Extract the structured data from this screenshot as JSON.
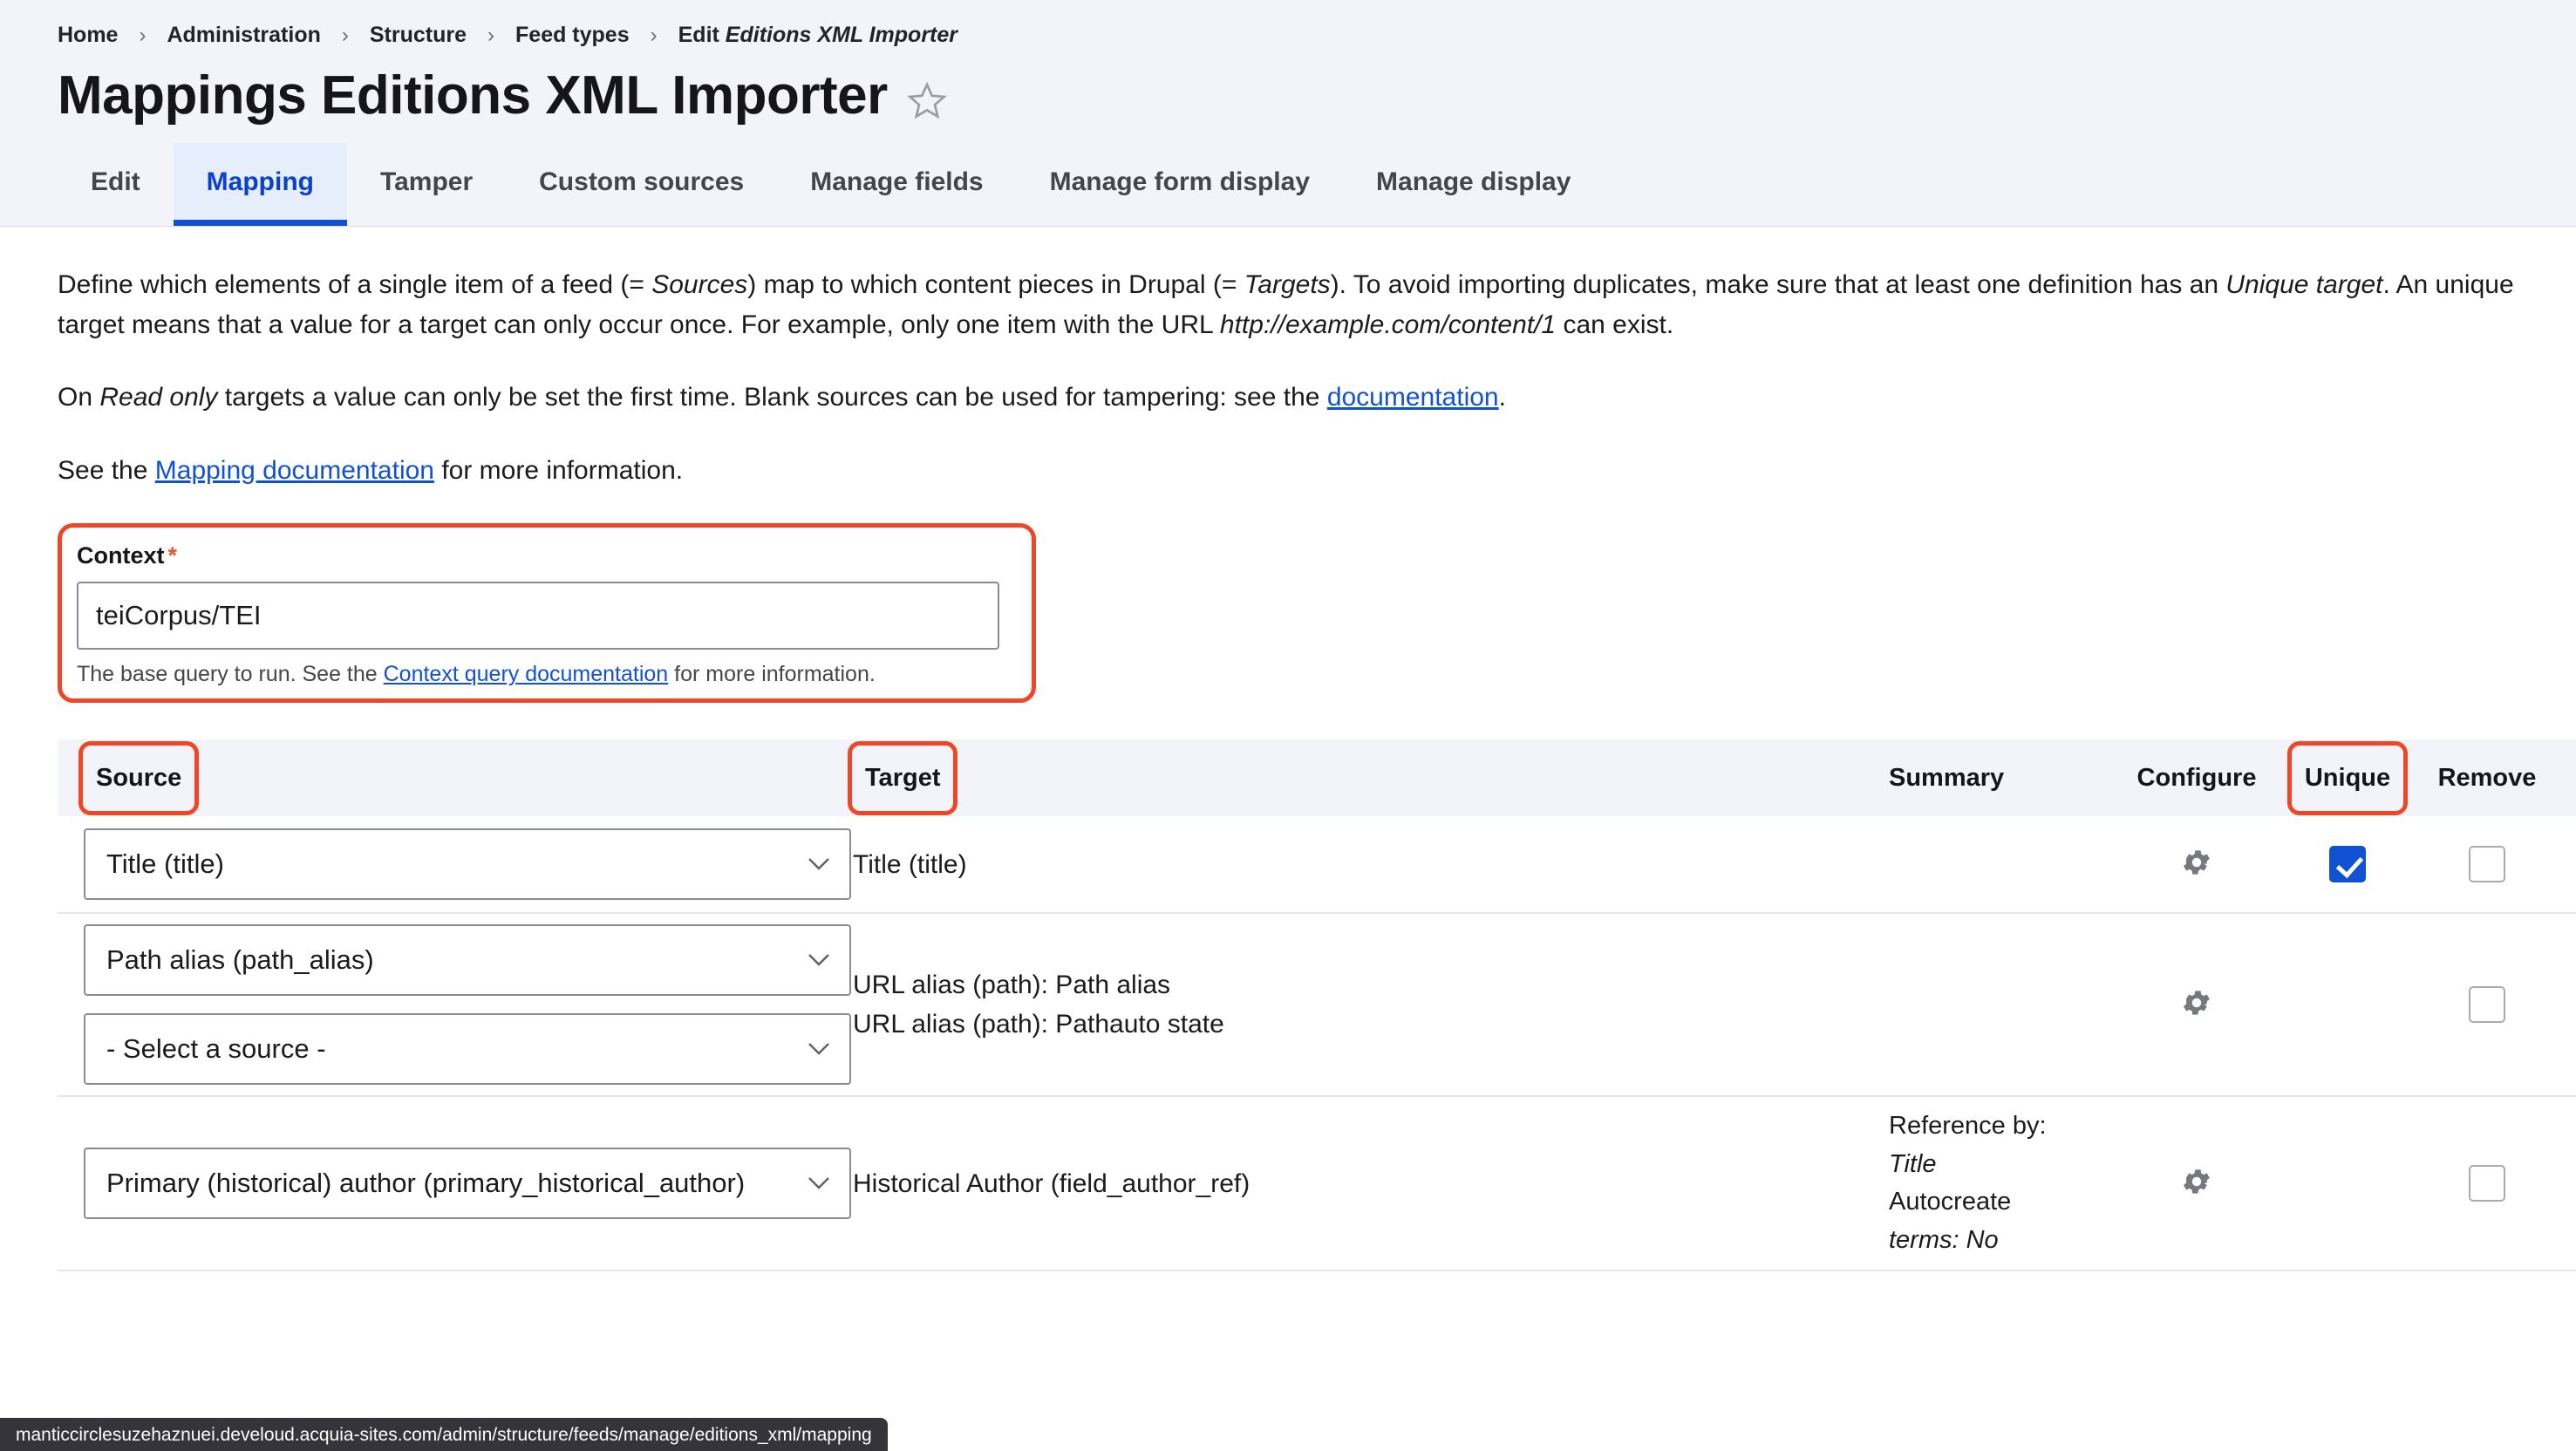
{
  "breadcrumb": {
    "items": [
      "Home",
      "Administration",
      "Structure",
      "Feed types"
    ],
    "last_prefix": "Edit ",
    "last_italic": "Editions XML Importer",
    "separator": "›"
  },
  "header": {
    "title": "Mappings Editions XML Importer",
    "star_icon": "star-outline-icon"
  },
  "tabs": [
    {
      "label": "Edit",
      "active": false
    },
    {
      "label": "Mapping",
      "active": true
    },
    {
      "label": "Tamper",
      "active": false
    },
    {
      "label": "Custom sources",
      "active": false
    },
    {
      "label": "Manage fields",
      "active": false
    },
    {
      "label": "Manage form display",
      "active": false
    },
    {
      "label": "Manage display",
      "active": false
    }
  ],
  "description": {
    "p1_a": "Define which elements of a single item of a feed (= ",
    "p1_i1": "Sources",
    "p1_b": ") map to which content pieces in Drupal (= ",
    "p1_i2": "Targets",
    "p1_c": "). To avoid importing duplicates, make sure that at least one definition has an ",
    "p1_i3": "Unique target",
    "p1_d": ". An unique target means that a value for a target can only occur once. For example, only one item with the URL ",
    "p1_i4": "http://example.com/content/1",
    "p1_e": " can exist.",
    "p2_a": "On ",
    "p2_i1": "Read only",
    "p2_b": " targets a value can only be set the first time. Blank sources can be used for tampering: see the ",
    "p2_link": "documentation",
    "p2_c": ".",
    "p3_a": "See the ",
    "p3_link": "Mapping documentation",
    "p3_b": " for more information."
  },
  "context_field": {
    "label": "Context",
    "required_marker": "*",
    "value": "teiCorpus/TEI",
    "desc_a": "The base query to run. See the ",
    "desc_link": "Context query documentation",
    "desc_b": " for more information."
  },
  "table": {
    "headers": {
      "source": "Source",
      "target": "Target",
      "summary": "Summary",
      "configure": "Configure",
      "unique": "Unique",
      "remove": "Remove"
    },
    "rows": [
      {
        "sources": [
          "Title (title)"
        ],
        "targets": [
          "Title (title)"
        ],
        "summary_lines": [],
        "configure_icon": "gear-icon",
        "unique_checked": true,
        "remove_checked": false
      },
      {
        "sources": [
          "Path alias (path_alias)",
          "- Select a source -"
        ],
        "targets": [
          "URL alias (path): Path alias",
          "URL alias (path): Pathauto state"
        ],
        "summary_lines": [],
        "configure_icon": "gear-icon",
        "unique_checked": null,
        "remove_checked": false
      },
      {
        "sources": [
          "Primary (historical) author (primary_historical_author)"
        ],
        "targets": [
          "Historical Author (field_author_ref)"
        ],
        "summary_lines": [
          "Reference by:",
          "Title",
          "Autocreate",
          "terms: No"
        ],
        "configure_icon": "gear-icon",
        "unique_checked": null,
        "remove_checked": false
      }
    ]
  },
  "statusbar": {
    "url": "manticcirclesuzehaznuei.develoud.acquia-sites.com/admin/structure/feeds/manage/editions_xml/mapping"
  },
  "colors": {
    "accent_blue": "#1151d3",
    "annotation_red": "#f04625",
    "header_bg": "#f3f4f9",
    "required_red": "#e8532b"
  }
}
